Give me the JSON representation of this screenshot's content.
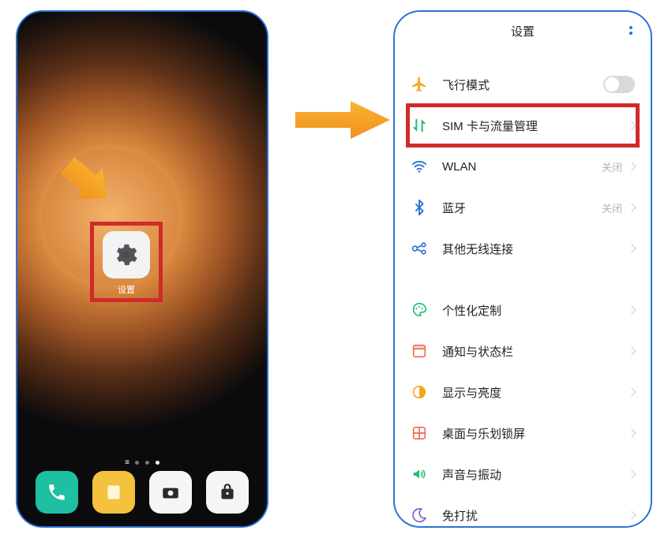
{
  "home": {
    "settings_app_label": "设置"
  },
  "settings": {
    "title": "设置",
    "rows": {
      "airplane": {
        "label": "飞行模式"
      },
      "sim": {
        "label": "SIM 卡与流量管理"
      },
      "wlan": {
        "label": "WLAN",
        "value": "关闭"
      },
      "bluetooth": {
        "label": "蓝牙",
        "value": "关闭"
      },
      "other_conn": {
        "label": "其他无线连接"
      },
      "personalize": {
        "label": "个性化定制"
      },
      "notif": {
        "label": "通知与状态栏"
      },
      "display": {
        "label": "显示与亮度"
      },
      "launcher": {
        "label": "桌面与乐划锁屏"
      },
      "sound": {
        "label": "声音与振动"
      },
      "dnd": {
        "label": "免打扰"
      }
    }
  },
  "colors": {
    "highlight": "#d02a2a",
    "accent": "#2b72d6",
    "arrow": "#f5a623"
  }
}
